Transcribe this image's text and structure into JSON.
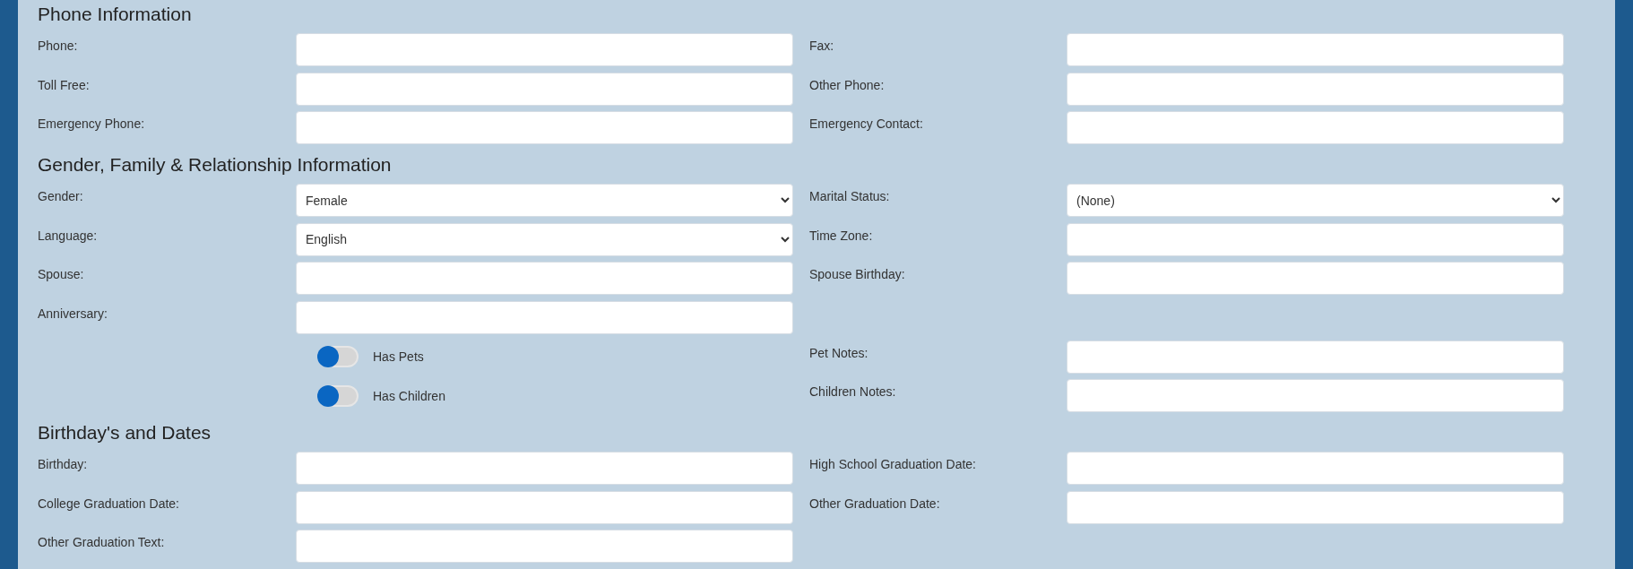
{
  "sections": [
    {
      "title": "Phone Information",
      "rows": [
        {
          "left": {
            "kind": "text",
            "label": "Phone:"
          },
          "right": {
            "kind": "text",
            "label": "Fax:"
          }
        },
        {
          "left": {
            "kind": "text",
            "label": "Toll Free:"
          },
          "right": {
            "kind": "text",
            "label": "Other Phone:"
          }
        },
        {
          "left": {
            "kind": "text",
            "label": "Emergency Phone:"
          },
          "right": {
            "kind": "text",
            "label": "Emergency Contact:"
          }
        }
      ]
    },
    {
      "title": "Gender, Family & Relationship Information",
      "rows": [
        {
          "left": {
            "kind": "select",
            "label": "Gender:",
            "value": "Female"
          },
          "right": {
            "kind": "select",
            "label": "Marital Status:",
            "value": "(None)"
          }
        },
        {
          "left": {
            "kind": "select",
            "label": "Language:",
            "value": "English"
          },
          "right": {
            "kind": "text",
            "label": "Time Zone:"
          }
        },
        {
          "left": {
            "kind": "text",
            "label": "Spouse:"
          },
          "right": {
            "kind": "text",
            "label": "Spouse Birthday:"
          }
        },
        {
          "left": {
            "kind": "text",
            "label": "Anniversary:"
          }
        },
        {
          "left": {
            "kind": "toggle",
            "label": "Has Pets",
            "on": false
          },
          "right": {
            "kind": "text",
            "label": "Pet Notes:"
          }
        },
        {
          "left": {
            "kind": "toggle",
            "label": "Has Children",
            "on": false
          },
          "right": {
            "kind": "text",
            "label": "Children Notes:"
          }
        }
      ]
    },
    {
      "title": "Birthday's and Dates",
      "rows": [
        {
          "left": {
            "kind": "text",
            "label": "Birthday:"
          },
          "right": {
            "kind": "text",
            "label": "High School Graduation Date:"
          }
        },
        {
          "left": {
            "kind": "text",
            "label": "College Graduation Date:"
          },
          "right": {
            "kind": "text",
            "label": "Other Graduation Date:"
          }
        },
        {
          "left": {
            "kind": "text",
            "label": "Other Graduation Text:"
          }
        }
      ]
    }
  ]
}
